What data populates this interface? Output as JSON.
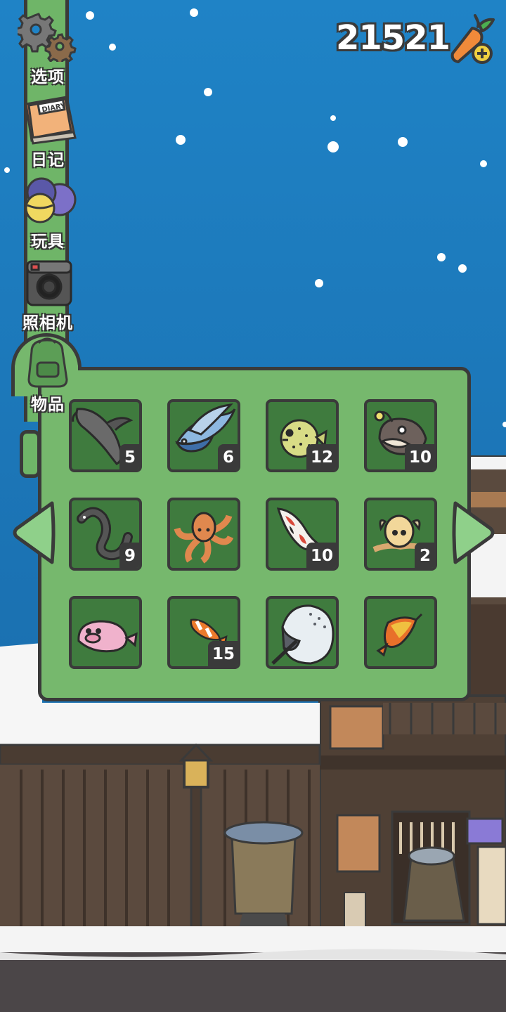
{
  "currency": {
    "amount": "21521",
    "icon": "carrot-plus-icon"
  },
  "menu": {
    "items": [
      {
        "id": "options",
        "label": "选项",
        "icon": "gear-icon"
      },
      {
        "id": "diary",
        "label": "日记",
        "icon": "diary-icon"
      },
      {
        "id": "toys",
        "label": "玩具",
        "icon": "toy-balls-icon"
      },
      {
        "id": "camera",
        "label": "照相机",
        "icon": "camera-icon"
      },
      {
        "id": "items",
        "label": "物品",
        "icon": "bag-icon"
      }
    ],
    "diary_cover_text": "DIARY"
  },
  "inventory": {
    "slots": [
      {
        "name": "catfish",
        "count": "5"
      },
      {
        "name": "flying-fish",
        "count": "6"
      },
      {
        "name": "pufferfish",
        "count": "12"
      },
      {
        "name": "anglerfish",
        "count": "10"
      },
      {
        "name": "eel",
        "count": "9"
      },
      {
        "name": "octopus",
        "count": ""
      },
      {
        "name": "koi",
        "count": "10"
      },
      {
        "name": "dumbo-octopus",
        "count": "2"
      },
      {
        "name": "blobfish",
        "count": ""
      },
      {
        "name": "clownfish",
        "count": "15"
      },
      {
        "name": "narwhal",
        "count": ""
      },
      {
        "name": "arowana",
        "count": ""
      }
    ],
    "nav": {
      "prev_icon": "left-arrow-icon",
      "next_icon": "right-arrow-icon"
    }
  },
  "colors": {
    "panel": "#76b86d",
    "slot": "#3f7b3e",
    "outline": "#3a3a3a",
    "sky": "#1f83c6"
  }
}
